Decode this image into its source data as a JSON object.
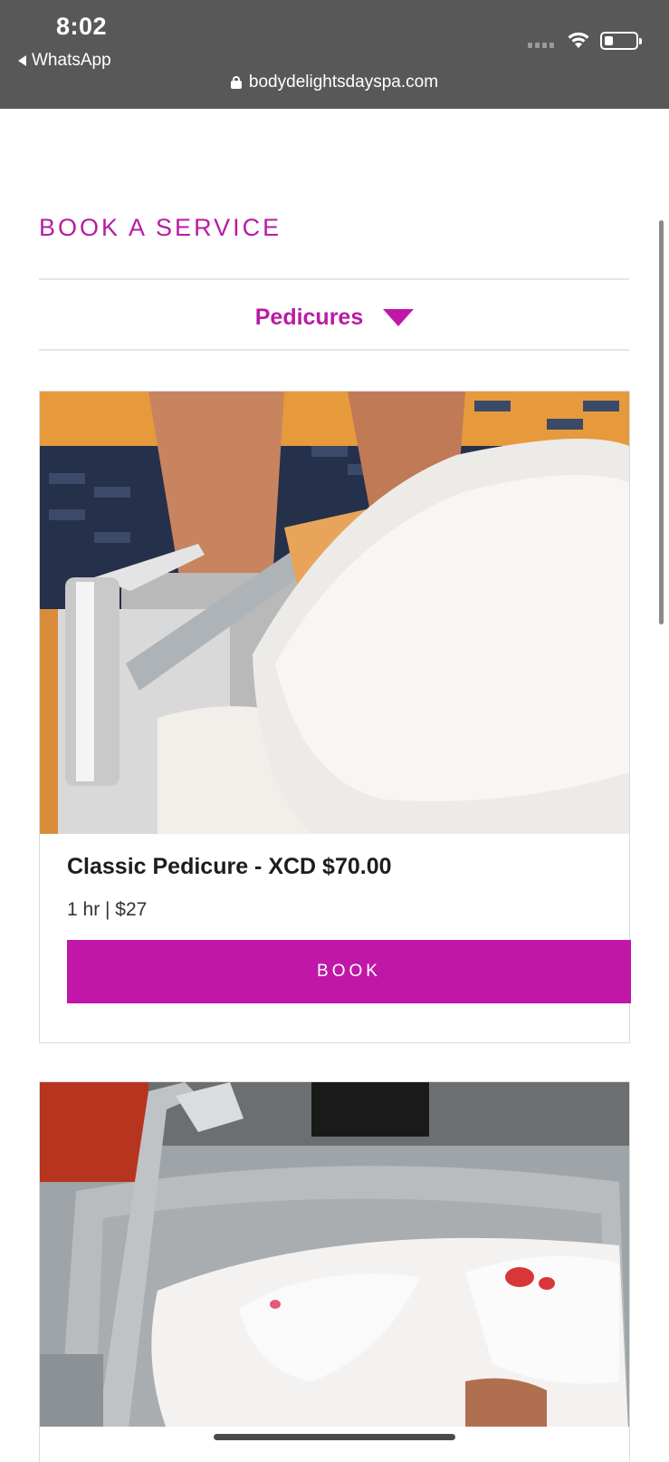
{
  "status_bar": {
    "time": "8:02",
    "back_app": "WhatsApp",
    "url": "bodydelightsdayspa.com"
  },
  "page": {
    "heading": "BOOK A SERVICE",
    "category": "Pedicures"
  },
  "services": [
    {
      "title": "Classic Pedicure - XCD $70.00",
      "meta": "1 hr  |  $27",
      "book_label": "BOOK"
    }
  ],
  "colors": {
    "accent": "#c017a8",
    "status_bar": "#585858"
  }
}
